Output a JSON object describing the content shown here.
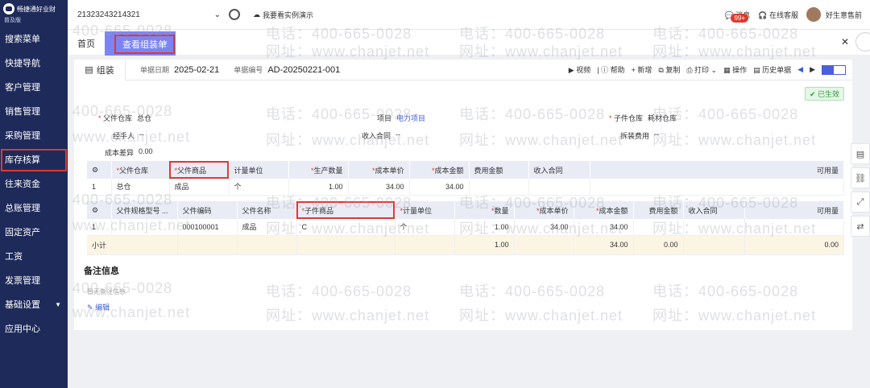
{
  "app": {
    "brand": "畅捷通好业财",
    "edition": "普及版"
  },
  "sidebar": {
    "items": [
      {
        "label": "搜索菜单"
      },
      {
        "label": "快捷导航"
      },
      {
        "label": "客户管理"
      },
      {
        "label": "销售管理"
      },
      {
        "label": "采购管理"
      },
      {
        "label": "库存核算",
        "active": true
      },
      {
        "label": "往来资金"
      },
      {
        "label": "总账管理"
      },
      {
        "label": "固定资产"
      },
      {
        "label": "工资"
      },
      {
        "label": "发票管理"
      },
      {
        "label": "基础设置",
        "expandable": true
      },
      {
        "label": "应用中心"
      }
    ]
  },
  "topbar": {
    "org": "21323243214321",
    "demo": "我要看实例演示",
    "messages": "消息",
    "badge": "99+",
    "service": "在线客服",
    "user": "好生意售前"
  },
  "tabs": {
    "home": "首页",
    "active": "查看组装单",
    "close": "×"
  },
  "doc": {
    "tab": "组装",
    "date_label": "单据日期",
    "date": "2025-02-21",
    "no_label": "单据编号",
    "no": "AD-20250221-001",
    "actions": [
      "视频",
      "帮助",
      "新增",
      "复制",
      "打印",
      "操作",
      "历史单据"
    ],
    "status": "已生效"
  },
  "form": {
    "parent_wh_label": "父件仓库",
    "parent_wh": "总仓",
    "handler_label": "经手人",
    "handler": "--",
    "cost_diff_label": "成本差异",
    "cost_diff": "0.00",
    "project_label": "项目",
    "project": "电力项目",
    "contract_label": "收入合同",
    "contract": "--",
    "child_wh_label": "子件仓库",
    "child_wh": "耗材仓库",
    "dismantle_label": "拆装费用",
    "dismantle": "--"
  },
  "parent_table": {
    "headers": [
      "父件仓库",
      "父件商品",
      "计量单位",
      "生产数量",
      "成本单价",
      "成本金额",
      "费用金额",
      "收入合同",
      "可用量"
    ],
    "row": [
      "1",
      "总仓",
      "成品",
      "个",
      "1.00",
      "34.00",
      "34.00",
      "",
      "",
      ""
    ]
  },
  "child_table": {
    "headers": [
      "父件规格型号 ...",
      "父件编码",
      "父件名称",
      "子件商品",
      "计量单位",
      "数量",
      "成本单价",
      "成本金额",
      "费用金额",
      "收入合同",
      "可用量"
    ],
    "row": [
      "1",
      "",
      "000100001",
      "成品",
      "C",
      "个",
      "1.00",
      "34.00",
      "34.00",
      "",
      "",
      ""
    ],
    "subtotal": {
      "label": "小计",
      "qty": "1.00",
      "amount": "34.00",
      "fee": "0.00",
      "avail": "0.00"
    }
  },
  "notes": {
    "title": "备注信息",
    "placeholder": "暂无备注信息",
    "edit": "编辑"
  },
  "watermark": {
    "phone": "电话：400-665-0028",
    "site": "网址：www.chanjet.net",
    "short": "400-665-0028",
    "short_site": "www.chanjet.net"
  }
}
